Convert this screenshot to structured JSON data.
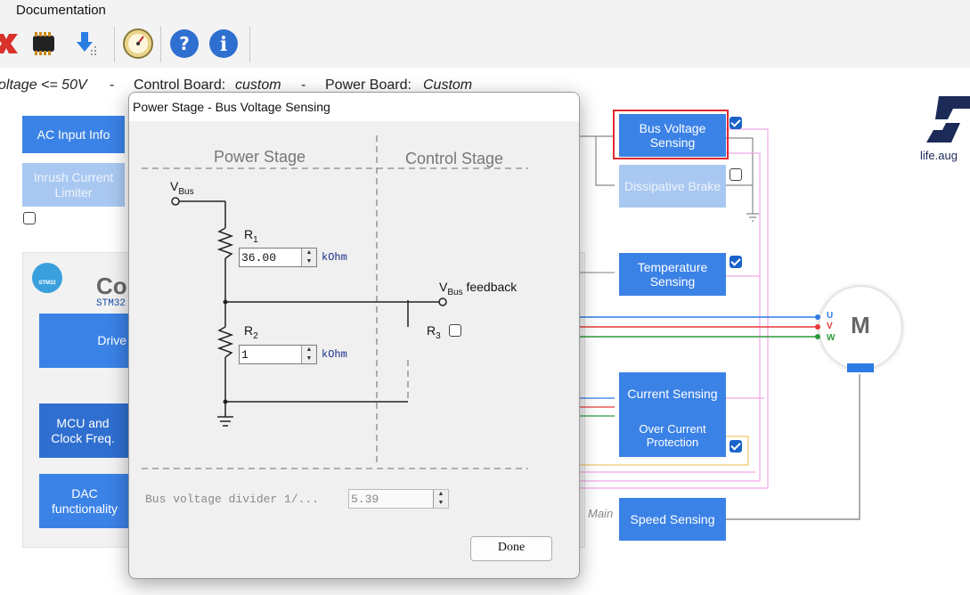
{
  "menu": {
    "documentation": "Documentation"
  },
  "subtitle": {
    "voltage": "oltage <= 50V",
    "dash1": "-",
    "control_label": "Control Board:",
    "control_value": "custom",
    "dash2": "-",
    "power_label": "Power Board:",
    "power_value": "Custom"
  },
  "left_blocks": {
    "ac_input": "AC Input Info",
    "inrush": "Inrush Current Limiter",
    "panel_title": "Co",
    "panel_sub": "STM32",
    "stm_logo": "STM32",
    "drive": "Drive",
    "mcu": "MCU and Clock Freq.",
    "dac": "DAC functionality"
  },
  "right_blocks": {
    "bus_voltage": "Bus Voltage Sensing",
    "dissipative": "Dissipative Brake",
    "temperature": "Temperature Sensing",
    "current": "Current Sensing",
    "ocp": "Over Current Protection",
    "speed": "Speed Sensing",
    "main_label": "Main",
    "motor": "M",
    "phase_u": "U",
    "phase_v": "V",
    "phase_w": "W",
    "logo_text": "life.aug"
  },
  "dialog": {
    "title": "Power Stage - Bus Voltage Sensing",
    "power_stage": "Power Stage",
    "control_stage": "Control Stage",
    "vbus": "V",
    "vbus_sub": "Bus",
    "r1": "R",
    "r1_sub": "1",
    "r1_value": "36.00",
    "r1_unit": "kOhm",
    "r2": "R",
    "r2_sub": "2",
    "r2_value": "1",
    "r2_unit": "kOhm",
    "r3": "R",
    "r3_sub": "3",
    "feedback_v": "V",
    "feedback_sub": "Bus",
    "feedback_text": "feedback",
    "divider_label": "Bus voltage divider 1/...",
    "divider_value": "5.39",
    "done": "Done"
  },
  "colors": {
    "block": "#3b82e6",
    "highlight": "#e0282e"
  }
}
